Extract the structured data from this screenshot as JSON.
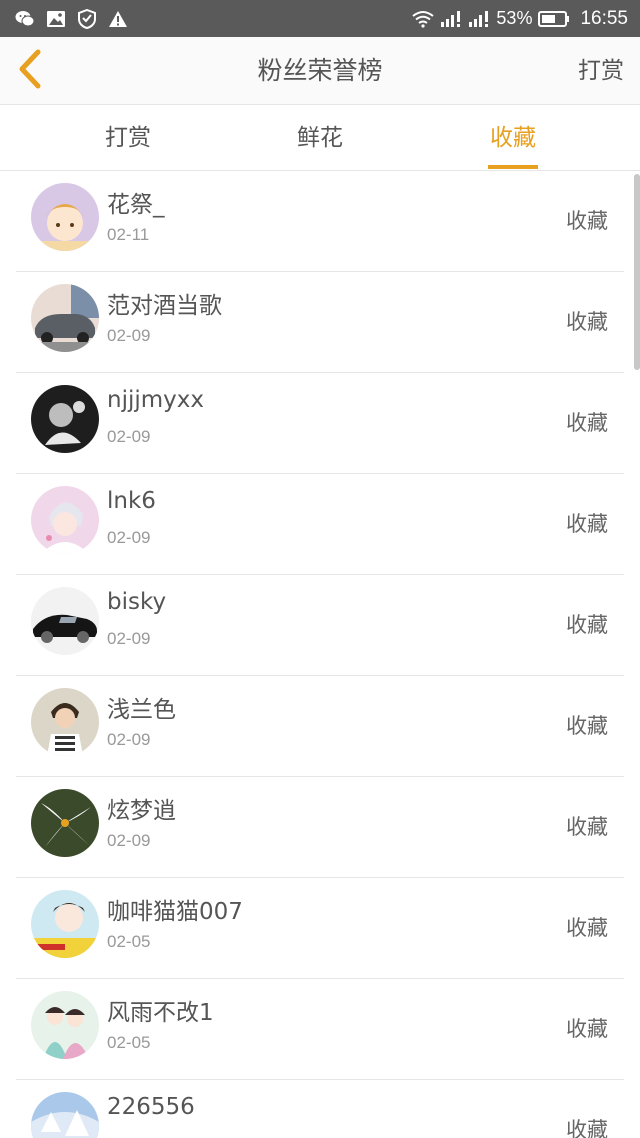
{
  "status_bar": {
    "battery": "53%",
    "time": "16:55",
    "icons_left": [
      "wechat-icon",
      "image-icon",
      "shield-icon",
      "warning-icon"
    ],
    "icons_right": [
      "wifi-icon",
      "signal-icon",
      "signal-icon",
      "battery-icon"
    ]
  },
  "header": {
    "title": "粉丝荣誉榜",
    "action": "打赏"
  },
  "tabs": [
    {
      "label": "打赏",
      "active": false
    },
    {
      "label": "鲜花",
      "active": false
    },
    {
      "label": "收藏",
      "active": true
    }
  ],
  "accent_color": "#e8a020",
  "list": [
    {
      "name": "花祭_",
      "date": "02-11",
      "action": "收藏"
    },
    {
      "name": "范对酒当歌",
      "date": "02-09",
      "action": "收藏"
    },
    {
      "name": "njjjmyxx",
      "date": "02-09",
      "action": "收藏"
    },
    {
      "name": "lnk6",
      "date": "02-09",
      "action": "收藏"
    },
    {
      "name": "bisky",
      "date": "02-09",
      "action": "收藏"
    },
    {
      "name": "浅兰色",
      "date": "02-09",
      "action": "收藏"
    },
    {
      "name": "炫梦逍",
      "date": "02-09",
      "action": "收藏"
    },
    {
      "name": "咖啡猫猫007",
      "date": "02-05",
      "action": "收藏"
    },
    {
      "name": "风雨不改1",
      "date": "02-05",
      "action": "收藏"
    },
    {
      "name": "226556",
      "date": "",
      "action": "收藏"
    }
  ]
}
